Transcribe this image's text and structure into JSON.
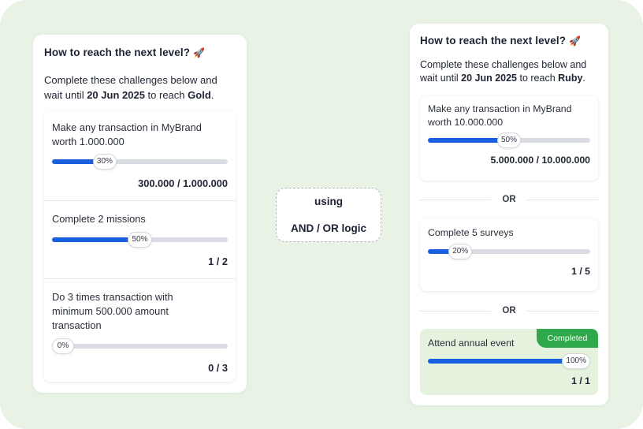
{
  "colors": {
    "background": "#e8f3e6",
    "progress_fill": "#1860e0",
    "progress_track": "#d9dde3",
    "completed_badge": "#2ea84a",
    "completed_card": "#e4f2de"
  },
  "left": {
    "title": "How to reach the next level?",
    "title_icon": "rocket-icon",
    "intro_prefix": "Complete these challenges below and wait until",
    "date": "20 Jun 2025",
    "intro_middle": "to reach",
    "level": "Gold",
    "intro_suffix": ".",
    "challenges": [
      {
        "text": "Make any transaction in MyBrand worth 1.000.000",
        "progress": 0.3,
        "pct_label": "30%",
        "count": "300.000 / 1.000.000"
      },
      {
        "text": "Complete 2 missions",
        "progress": 0.5,
        "pct_label": "50%",
        "count": "1 / 2"
      },
      {
        "text": "Do 3 times transaction with minimum 500.000 amount transaction",
        "progress": 0.0,
        "pct_label": "0%",
        "count": "0 / 3"
      }
    ]
  },
  "logic": {
    "line1": "using",
    "line2": "AND / OR logic"
  },
  "right": {
    "title": "How to reach the next level?",
    "title_icon": "rocket-icon",
    "intro_prefix": "Complete these challenges below and wait until",
    "date": "20 Jun 2025",
    "intro_middle": "to reach",
    "level": "Ruby",
    "intro_suffix": ".",
    "or_label": "OR",
    "challenges": [
      {
        "text": "Make any transaction in MyBrand worth 10.000.000",
        "progress": 0.5,
        "pct_label": "50%",
        "count": "5.000.000 / 10.000.000"
      },
      {
        "text": "Complete 5 surveys",
        "progress": 0.2,
        "pct_label": "20%",
        "count": "1 / 5"
      },
      {
        "text": "Attend annual event",
        "progress": 1.0,
        "pct_label": "100%",
        "count": "1 / 1",
        "badge": "Completed"
      }
    ]
  }
}
